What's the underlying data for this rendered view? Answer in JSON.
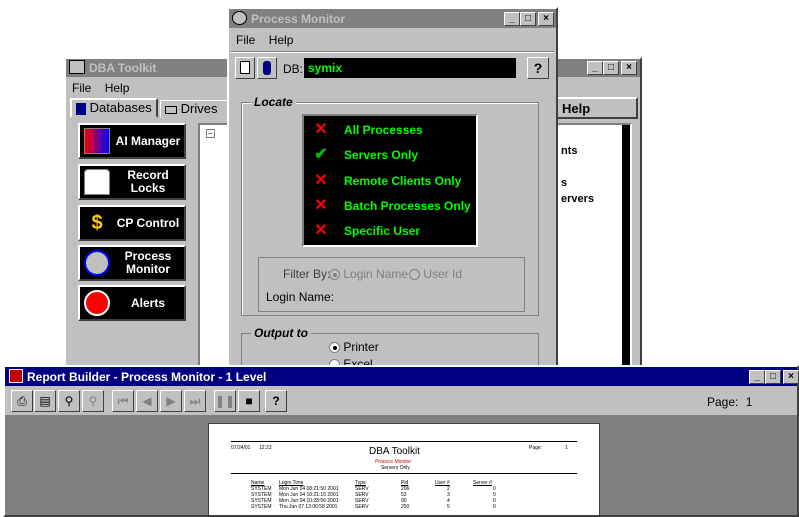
{
  "dba_window": {
    "title": "DBA Toolkit",
    "menu": [
      "File",
      "Help"
    ],
    "tabs": [
      "Databases",
      "Drives"
    ],
    "nav_buttons": [
      {
        "label": "AI Manager"
      },
      {
        "label": "Record Locks"
      },
      {
        "label": "CP Control"
      },
      {
        "label": "Process Monitor"
      },
      {
        "label": "Alerts"
      }
    ],
    "tree_tab": "Help",
    "side_text": [
      "nts",
      "s",
      "ervers"
    ]
  },
  "process_monitor": {
    "title": "Process Monitor",
    "menu": [
      "File",
      "Help"
    ],
    "db_label": "DB:",
    "db_value": "symix",
    "locate_label": "Locate",
    "options": [
      {
        "label": "All Processes",
        "mark": "x",
        "color": "#ff0000"
      },
      {
        "label": "Servers Only",
        "mark": "check",
        "color": "#00c000"
      },
      {
        "label": "Remote Clients Only",
        "mark": "x",
        "color": "#ff0000"
      },
      {
        "label": "Batch Processes Only",
        "mark": "x",
        "color": "#ff0000"
      },
      {
        "label": "Specific User",
        "mark": "x",
        "color": "#ff0000"
      }
    ],
    "filter_label": "Filter By:",
    "filter_options": [
      "Login Name",
      "User Id"
    ],
    "login_label": "Login Name:",
    "output_label": "Output to",
    "output_options": [
      {
        "label": "Printer",
        "selected": true
      },
      {
        "label": "Excel",
        "selected": false
      }
    ]
  },
  "report_builder": {
    "title": "Report Builder - Process Monitor - 1 Level",
    "page_label": "Page:",
    "page_value": "1",
    "report": {
      "date": "07/24/01",
      "time": "12:23",
      "title": "DBA Toolkit",
      "subtitle": "Process Monitor",
      "subtitle2": "Servers Only",
      "page_label": "Page:",
      "page_num": "1",
      "columns": [
        "Name",
        "Login Time",
        "Type",
        "Pid",
        "User #",
        "Server #"
      ],
      "rows": [
        [
          "SYSTEM",
          "Mon Jun 04 08:21:50 2001",
          "SERV",
          "206",
          "2",
          "0"
        ],
        [
          "SYSTEM",
          "Mon Jun 04 10:21:15 2001",
          "SERV",
          "52",
          "3",
          "0"
        ],
        [
          "SYSTEM",
          "Mon Jun 04 10:28:56 2001",
          "SERV",
          "90",
          "4",
          "0"
        ],
        [
          "SYSTEM",
          "Thu Jun 07 13:06:58 2001",
          "SERV",
          "250",
          "5",
          "0"
        ]
      ]
    }
  }
}
